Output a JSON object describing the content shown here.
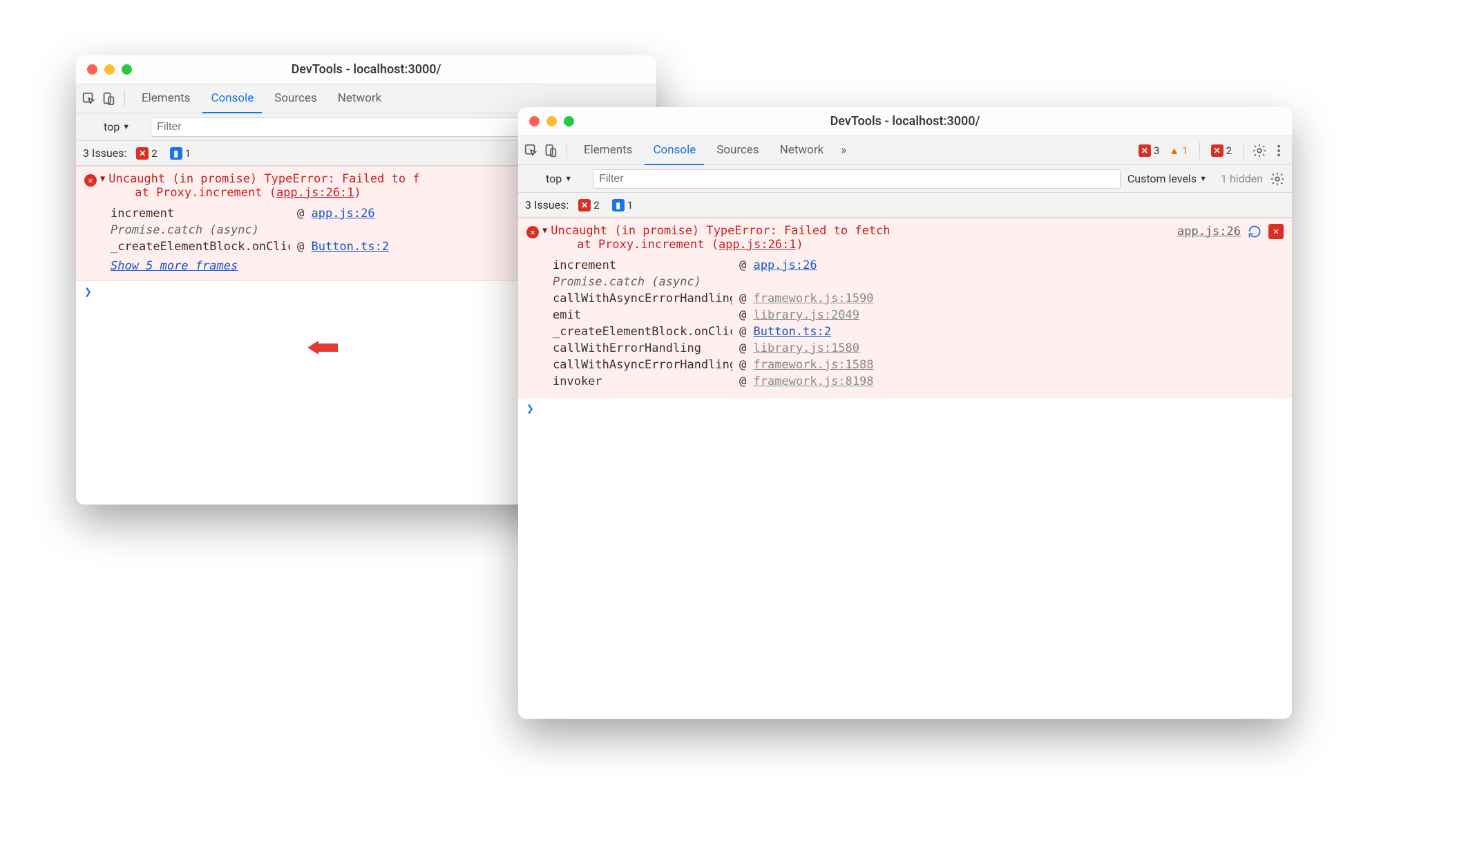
{
  "win1": {
    "title": "DevTools - localhost:3000/",
    "tabs": {
      "elements": "Elements",
      "console": "Console",
      "sources": "Sources",
      "network": "Network"
    },
    "subbar": {
      "context": "top",
      "filter_placeholder": "Filter"
    },
    "issues": {
      "label": "3 Issues:",
      "err": "2",
      "info": "1"
    },
    "error": {
      "headline": "Uncaught (in promise) TypeError: Failed to f",
      "at_line": "at Proxy.increment (",
      "at_link": "app.js:26:1",
      "at_close": ")",
      "stack": [
        {
          "fn": "increment",
          "link": "app.js:26",
          "cls": "blue"
        },
        {
          "fn": "Promise.catch (async)",
          "async": true
        },
        {
          "fn": "_createElementBlock.onClick",
          "link": "Button.ts:2",
          "cls": "blue"
        }
      ],
      "show_more": "Show 5 more frames"
    }
  },
  "win2": {
    "title": "DevTools - localhost:3000/",
    "tabs": {
      "elements": "Elements",
      "console": "Console",
      "sources": "Sources",
      "network": "Network"
    },
    "tabbadges": {
      "err": "3",
      "warn": "1",
      "msg": "2"
    },
    "subbar": {
      "context": "top",
      "filter_placeholder": "Filter",
      "levels": "Custom levels",
      "hidden": "1 hidden"
    },
    "issues": {
      "label": "3 Issues:",
      "err": "2",
      "info": "1"
    },
    "error": {
      "headline": "Uncaught (in promise) TypeError: Failed to fetch",
      "at_line": "at Proxy.increment (",
      "at_link": "app.js:26:1",
      "at_close": ")",
      "srclink": "app.js:26",
      "stack": [
        {
          "fn": "increment",
          "link": "app.js:26",
          "cls": "blue"
        },
        {
          "fn": "Promise.catch (async)",
          "async": true
        },
        {
          "fn": "callWithAsyncErrorHandling",
          "link": "framework.js:1590",
          "cls": "grey"
        },
        {
          "fn": "emit",
          "link": "library.js:2049",
          "cls": "grey"
        },
        {
          "fn": "_createElementBlock.onClick",
          "link": "Button.ts:2",
          "cls": "blue"
        },
        {
          "fn": "callWithErrorHandling",
          "link": "library.js:1580",
          "cls": "grey"
        },
        {
          "fn": "callWithAsyncErrorHandling",
          "link": "framework.js:1588",
          "cls": "grey"
        },
        {
          "fn": "invoker",
          "link": "framework.js:8198",
          "cls": "grey"
        }
      ]
    }
  },
  "sym": {
    "at": "@",
    "tri": "▶",
    "cross": "✕",
    "msg": "▮"
  }
}
